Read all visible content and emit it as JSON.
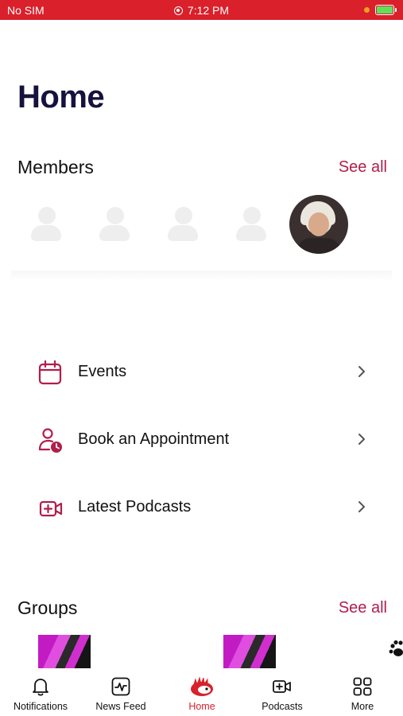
{
  "status_bar": {
    "carrier": "No SIM",
    "time": "7:12 PM",
    "battery_level": 1.0
  },
  "page": {
    "title": "Home"
  },
  "members": {
    "title": "Members",
    "see_all": "See all"
  },
  "menu": {
    "items": [
      {
        "label": "Events",
        "icon": "calendar-icon"
      },
      {
        "label": "Book an Appointment",
        "icon": "person-clock-icon"
      },
      {
        "label": "Latest Podcasts",
        "icon": "video-plus-icon"
      }
    ]
  },
  "groups": {
    "title": "Groups",
    "see_all": "See all"
  },
  "tab_bar": {
    "tabs": [
      {
        "label": "Notifications",
        "icon": "bell-icon"
      },
      {
        "label": "News Feed",
        "icon": "pulse-icon"
      },
      {
        "label": "Home",
        "icon": "home-logo-icon",
        "active": true
      },
      {
        "label": "Podcasts",
        "icon": "video-plus-icon"
      },
      {
        "label": "More",
        "icon": "grid-icon"
      }
    ]
  },
  "colors": {
    "status_bar": "#d9202b",
    "accent": "#b01e4a",
    "title": "#15123f",
    "active_tab": "#d9202b"
  }
}
